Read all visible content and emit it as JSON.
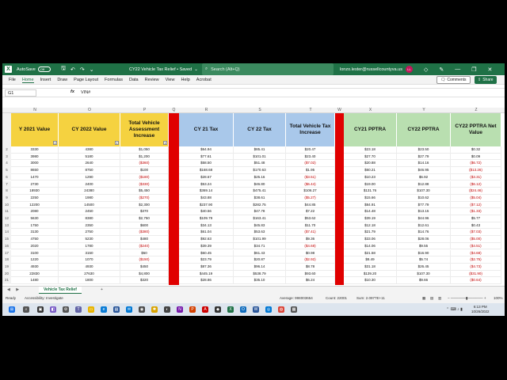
{
  "titlebar": {
    "autosave_label": "AutoSave",
    "autosave_state": "Off",
    "doc_title": "CY22 Vehicle Tax Relief • Saved",
    "search_placeholder": "Search (Alt+Q)",
    "user_email": "lonzo.lester@russellcountyva.us",
    "avatar_initials": "LL"
  },
  "ribbon": {
    "tabs": [
      "File",
      "Home",
      "Insert",
      "Draw",
      "Page Layout",
      "Formulas",
      "Data",
      "Review",
      "View",
      "Help",
      "Acrobat"
    ],
    "comments_label": "Comments",
    "share_label": "Share"
  },
  "formula_bar": {
    "name_box": "G1",
    "fx": "fx",
    "content": "VIN#"
  },
  "columns": [
    "N",
    "O",
    "P",
    "Q",
    "R",
    "S",
    "T",
    "W",
    "X",
    "Y",
    "Z"
  ],
  "headers": {
    "cy2021_value": "Y 2021 Value",
    "cy2022_value": "CY 2022 Value",
    "total_assess": "Total Vehicle Assessment Increase",
    "cy21_tax": "CY 21 Tax",
    "cy22_tax": "CY 22 Tax",
    "total_tax": "Total Vehicle Tax Increase",
    "cy21_pptra": "CY21 PPTRA",
    "cy22_pptra": "CY22 PPTRA",
    "cy22_net": "CY22 PPTRA Net Value"
  },
  "rows": [
    {
      "n": "2",
      "v21": "3330",
      "v22": "4380",
      "inc": "$1,050",
      "t21": "$64.94",
      "t22": "$85.41",
      "tinc": "$20.47",
      "p21": "$23.18",
      "p22": "$23.50",
      "net": "$0.32"
    },
    {
      "n": "3",
      "v21": "3980",
      "v22": "5180",
      "inc": "$1,200",
      "t21": "$77.61",
      "t22": "$101.01",
      "tinc": "$23.40",
      "p21": "$27.70",
      "p22": "$27.79",
      "net": "$0.09"
    },
    {
      "n": "4",
      "v21": "3000",
      "v22": "2640",
      "inc": "($360)",
      "t21": "$58.50",
      "t22": "$51.48",
      "tinc": "($7.02)",
      "p21": "$20.88",
      "p22": "$14.16",
      "net": "($6.72)"
    },
    {
      "n": "5",
      "v21": "8650",
      "v22": "8750",
      "inc": "$100",
      "t21": "$168.68",
      "t22": "$170.63",
      "tinc": "$1.95",
      "p21": "$60.21",
      "p22": "$46.95",
      "net": "($13.26)"
    },
    {
      "n": "6",
      "v21": "1470",
      "v22": "1290",
      "inc": "($180)",
      "t21": "$28.67",
      "t22": "$25.16",
      "tinc": "($3.51)",
      "p21": "$10.23",
      "p22": "$6.92",
      "net": "($3.31)"
    },
    {
      "n": "7",
      "v21": "2730",
      "v22": "2400",
      "inc": "($330)",
      "t21": "$53.24",
      "t22": "$46.80",
      "tinc": "($6.44)",
      "p21": "$19.00",
      "p22": "$12.88",
      "net": "($6.12)"
    },
    {
      "n": "8",
      "v21": "18930",
      "v22": "24380",
      "inc": "$5,450",
      "t21": "$369.14",
      "t22": "$475.41",
      "tinc": "$106.27",
      "p21": "$131.76",
      "p22": "$107.30",
      "net": "($24.46)"
    },
    {
      "n": "9",
      "v21": "2250",
      "v22": "1980",
      "inc": "($270)",
      "t21": "$43.88",
      "t22": "$38.61",
      "tinc": "($5.27)",
      "p21": "$15.66",
      "p22": "$10.62",
      "net": "($5.04)"
    },
    {
      "n": "10",
      "v21": "12200",
      "v22": "14500",
      "inc": "$2,300",
      "t21": "$237.90",
      "t22": "$282.75",
      "tinc": "$44.85",
      "p21": "$84.91",
      "p22": "$77.79",
      "net": "($7.12)"
    },
    {
      "n": "11",
      "v21": "2080",
      "v22": "2450",
      "inc": "$370",
      "t21": "$40.56",
      "t22": "$47.78",
      "tinc": "$7.22",
      "p21": "$14.48",
      "p22": "$13.15",
      "net": "($1.33)"
    },
    {
      "n": "12",
      "v21": "5630",
      "v22": "8380",
      "inc": "$2,750",
      "t21": "$109.79",
      "t22": "$163.41",
      "tinc": "$53.62",
      "p21": "$39.19",
      "p22": "$44.96",
      "net": "$5.77"
    },
    {
      "n": "13",
      "v21": "1750",
      "v22": "2350",
      "inc": "$600",
      "t21": "$34.13",
      "t22": "$45.83",
      "tinc": "$11.70",
      "p21": "$12.18",
      "p22": "$12.61",
      "net": "$0.43"
    },
    {
      "n": "14",
      "v21": "3130",
      "v22": "2750",
      "inc": "($380)",
      "t21": "$61.04",
      "t22": "$53.63",
      "tinc": "($7.41)",
      "p21": "$21.79",
      "p22": "$14.76",
      "net": "($7.03)"
    },
    {
      "n": "15",
      "v21": "4750",
      "v22": "5230",
      "inc": "$480",
      "t21": "$92.63",
      "t22": "$101.99",
      "tinc": "$9.36",
      "p21": "$33.06",
      "p22": "$28.06",
      "net": "($5.00)"
    },
    {
      "n": "16",
      "v21": "2020",
      "v22": "1780",
      "inc": "($240)",
      "t21": "$39.39",
      "t22": "$34.71",
      "tinc": "($4.68)",
      "p21": "$14.06",
      "p22": "$9.55",
      "net": "($4.51)"
    },
    {
      "n": "17",
      "v21": "3100",
      "v22": "3150",
      "inc": "$50",
      "t21": "$60.45",
      "t22": "$61.43",
      "tinc": "$0.98",
      "p21": "$21.58",
      "p22": "$16.90",
      "net": "($4.68)"
    },
    {
      "n": "18",
      "v21": "1220",
      "v22": "1070",
      "inc": "($150)",
      "t21": "$23.79",
      "t22": "$20.87",
      "tinc": "($2.92)",
      "p21": "$8.49",
      "p22": "$5.74",
      "net": "($2.75)"
    },
    {
      "n": "19",
      "v21": "4930",
      "v22": "4930",
      "inc": "$450",
      "t21": "$87.36",
      "t22": "$96.14",
      "tinc": "$8.78",
      "p21": "$31.18",
      "p22": "$26.45",
      "net": "($4.73)"
    },
    {
      "n": "20",
      "v21": "22830",
      "v22": "27630",
      "inc": "$4,800",
      "t21": "$445.19",
      "t22": "$538.79",
      "tinc": "$93.60",
      "p21": "$139.20",
      "p22": "$107.30",
      "net": "($31.90)"
    },
    {
      "n": "21",
      "v21": "1480",
      "v22": "1800",
      "inc": "$320",
      "t21": "$28.86",
      "t22": "$35.10",
      "tinc": "$6.24",
      "p21": "$10.30",
      "p22": "$9.66",
      "net": "($0.64)"
    }
  ],
  "sheet_tabs": {
    "nav": "◀ ▶",
    "active": "Vehicle Tax Relief",
    "add": "+"
  },
  "status_bar": {
    "ready": "Ready",
    "accessibility": "Accessibility: Investigate",
    "average": "Average: 998003654",
    "count": "Count: 22001",
    "sum": "Sum: 2.0977E+11",
    "zoom": "100%"
  },
  "taskbar": {
    "time": "6:13 PM",
    "date": "10/26/2022"
  },
  "colors": {
    "excel_green": "#1f7146",
    "yellow_header": "#f5d240",
    "blue_header": "#a9c8ea",
    "green_header": "#b9dfb0",
    "red_divider": "#e00000",
    "negative_text": "#c00000"
  }
}
